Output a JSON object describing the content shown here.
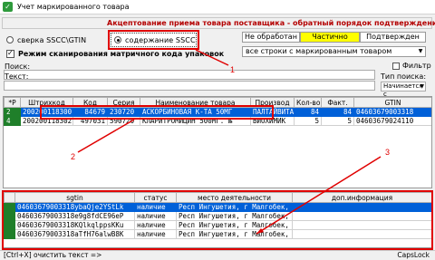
{
  "window": {
    "title": "Учет маркированного товара"
  },
  "caption": "Акцептование приема товара поставщика - обратный порядок подтверждения",
  "mode": {
    "option_sscc_gtin": "сверка SSCC\\GTIN",
    "option_content_sscc": "содержание  SSCC",
    "selected": "содержание  SSCC"
  },
  "matrix_scan": {
    "label": "Режим сканирования матричного кода упаковок",
    "checked": true
  },
  "status_tabs": [
    {
      "label": "Не обработан",
      "active": false
    },
    {
      "label": "Частично",
      "active": true
    },
    {
      "label": "Подтвержден",
      "active": false
    }
  ],
  "status_filter": {
    "value": "все строки с маркированным товаром"
  },
  "search": {
    "search_label": "Поиск:",
    "text_label": "Текст:",
    "filter_label": "Фильтр",
    "search_type_label": "Тип поиска:",
    "search_type_value": "Начинается с"
  },
  "goods_table": {
    "columns": [
      "*P",
      "Штрихкод",
      "Код",
      "Серия",
      "Наименование товара",
      "Производ",
      "Кол-во",
      "Факт.",
      "GTIN"
    ],
    "rows": [
      {
        "mark": "2",
        "barcode": "200200118300",
        "code": "84679",
        "series": "230720",
        "name": "АСКОРБИНОВАЯ К-ТА 50МГ",
        "producer": "ПАЛТАЙВИТА",
        "qty": "84",
        "fact": "84",
        "gtin": "04603679003318",
        "selected": true
      },
      {
        "mark": "4",
        "barcode": "200200118302",
        "code": "497031",
        "series": "590720",
        "name": "КЛАРИТРОМИЦИН 500МГ. №",
        "producer": "ВИОХИМИК",
        "qty": "5",
        "fact": "5",
        "gtin": "04603679024110",
        "selected": false
      }
    ]
  },
  "sgtin_table": {
    "columns": [
      "sgtin",
      "статус",
      "место деятельности",
      "доп.информация"
    ],
    "rows": [
      {
        "sgtin": "04603679003318ybaQje2YStLk",
        "status": "наличие",
        "place": "Респ Ингушетия, г Малгобек, ул",
        "info": "",
        "selected": true
      },
      {
        "sgtin": "04603679003318e9g8fdCE96eP",
        "status": "наличие",
        "place": "Респ Ингушетия, г Малгобек, ул",
        "info": "",
        "selected": false
      },
      {
        "sgtin": "04603679003318KQlkqlppsKKu",
        "status": "наличие",
        "place": "Респ Ингушетия, г Малгобек, ул",
        "info": "",
        "selected": false
      },
      {
        "sgtin": "04603679003318aTfH76alwB8K",
        "status": "наличие",
        "place": "Респ Ингушетия, г Малгобек, ул",
        "info": "",
        "selected": false
      }
    ]
  },
  "annotations": [
    "1",
    "2",
    "3"
  ],
  "status_bar": {
    "hint": "[Ctrl+X] очистить текст =>",
    "caps": "CapsLock"
  },
  "colors": {
    "annotation": "#e00000",
    "selection": "#0060d8",
    "mark": "#1f7f2a",
    "caption_text": "#b40000",
    "active_tab": "#ffff00"
  }
}
